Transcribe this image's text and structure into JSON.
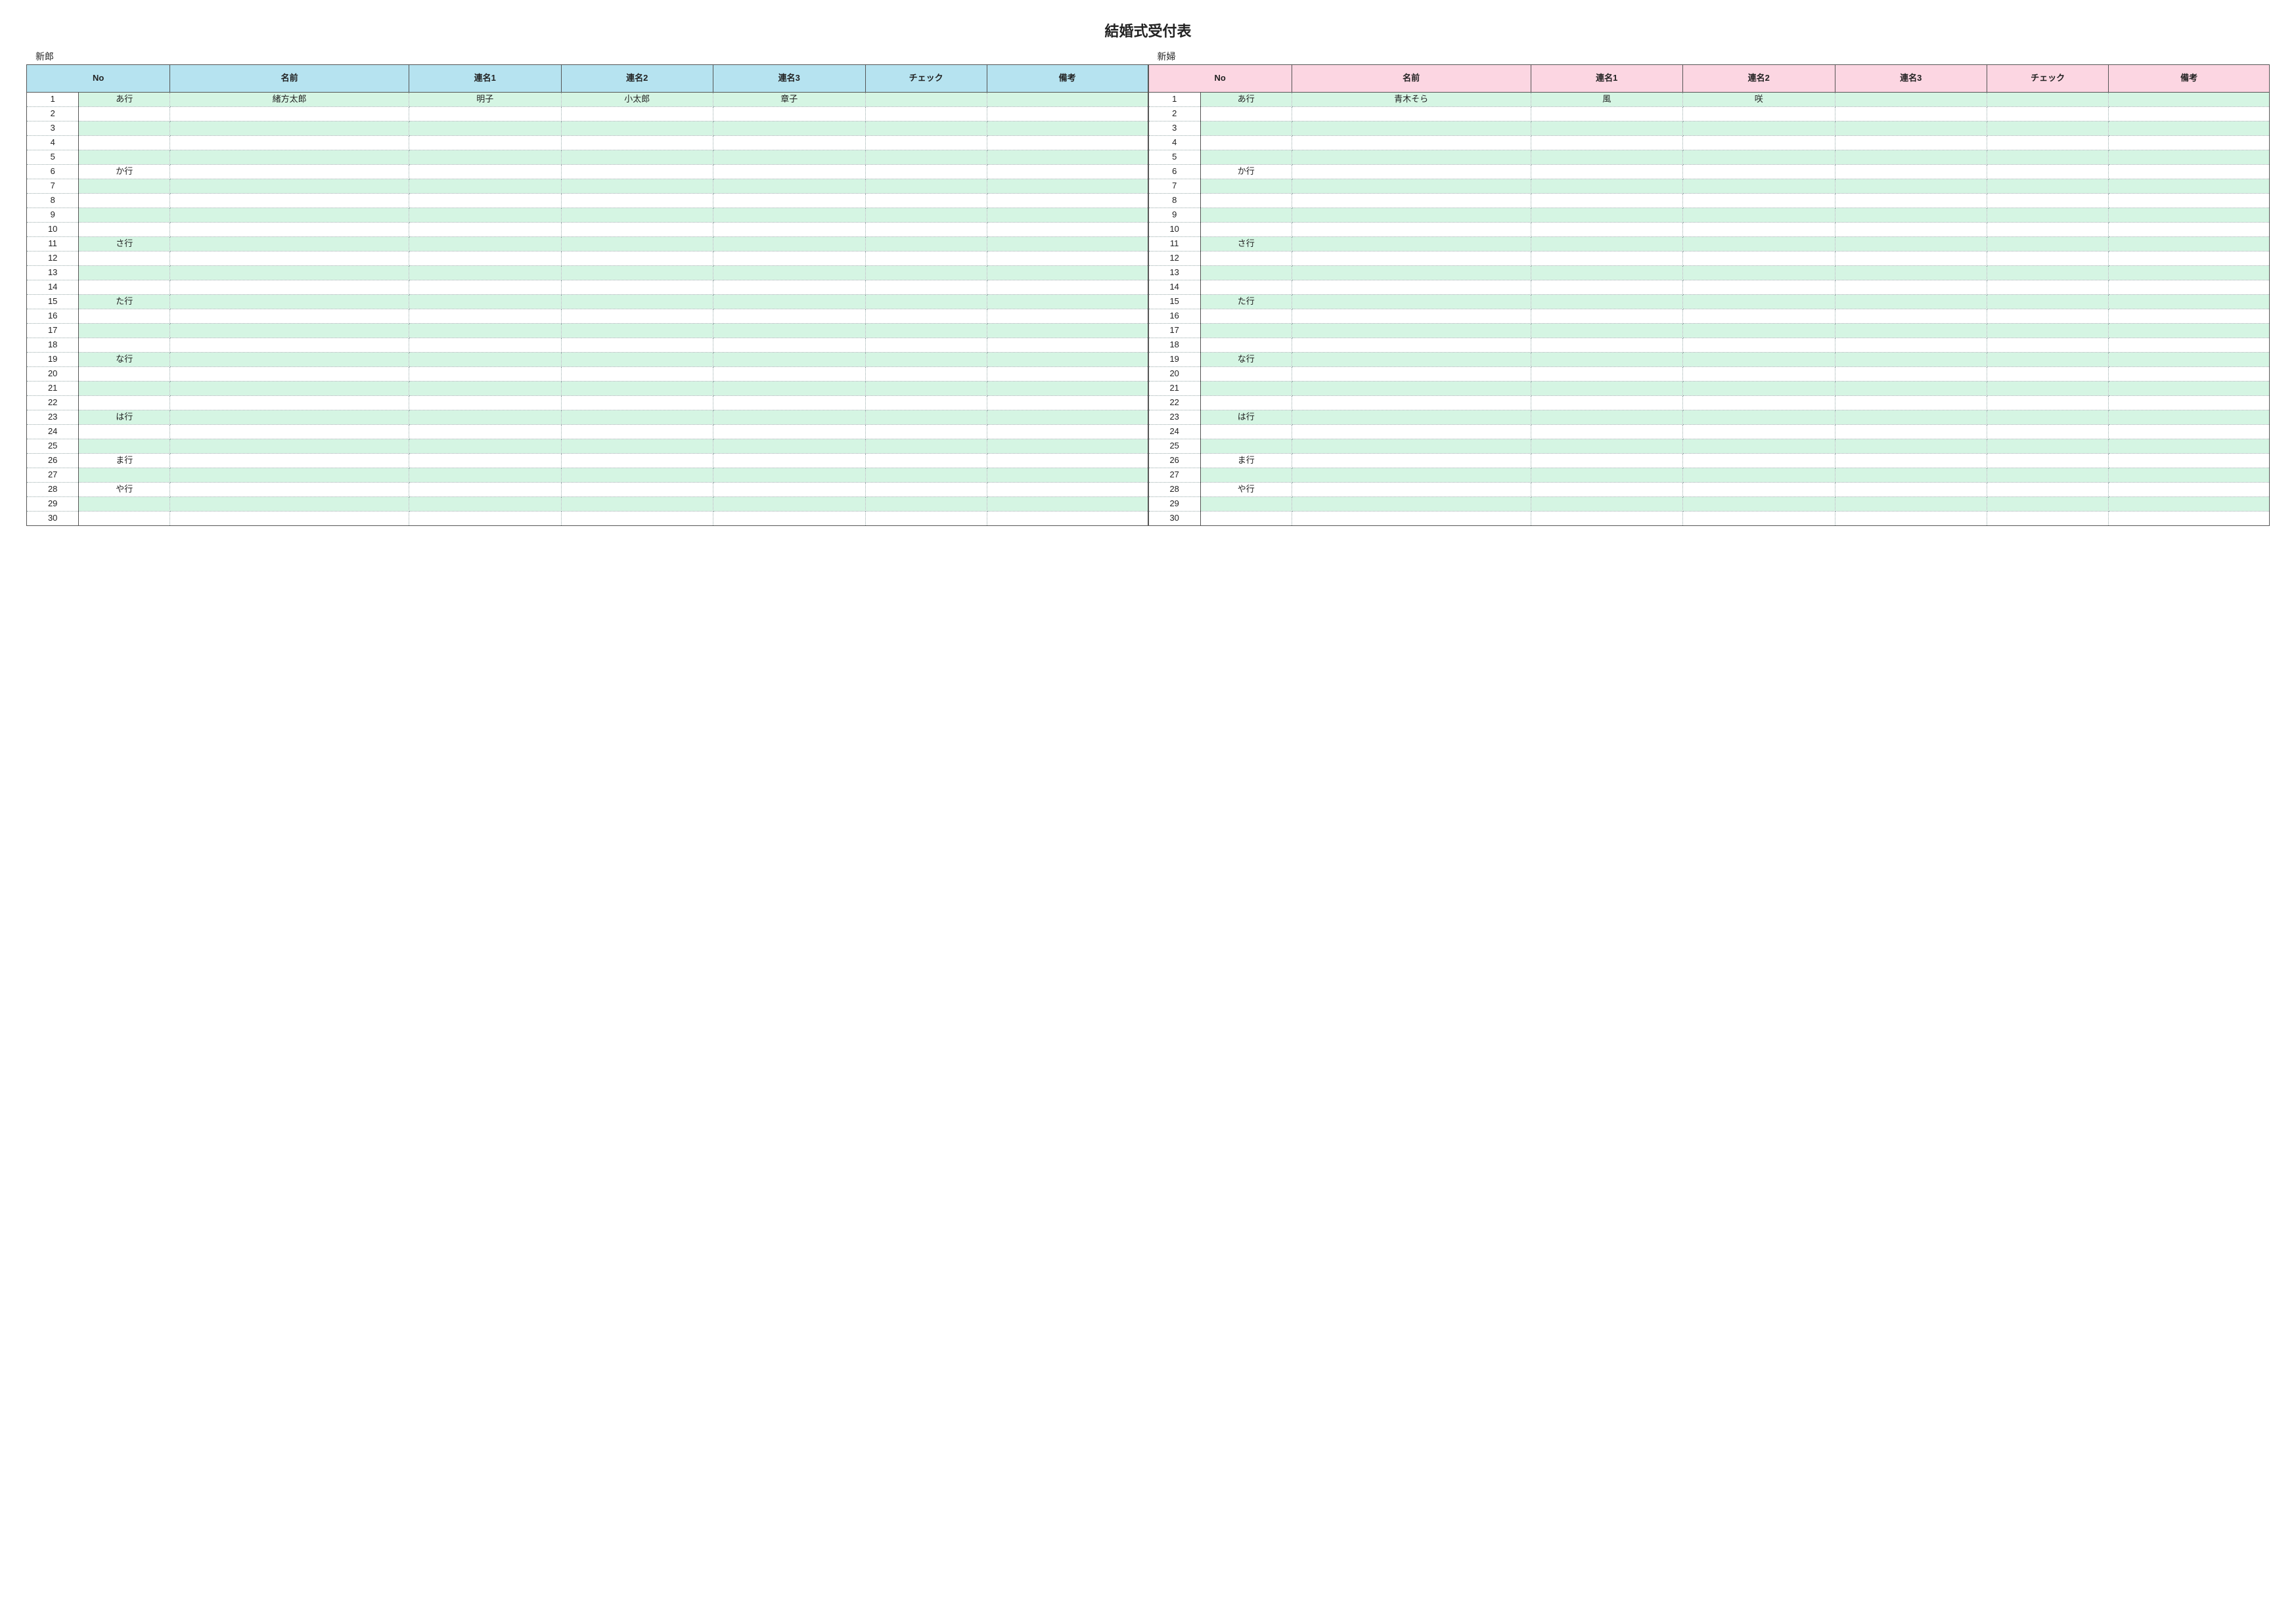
{
  "title": "結婚式受付表",
  "sides": [
    {
      "label": "新郎",
      "header_class": "hdr-blue",
      "columns": [
        "No",
        "名前",
        "連名1",
        "連名2",
        "連名3",
        "チェック",
        "備考"
      ],
      "rows": [
        {
          "n": 1,
          "kana": "あ行",
          "name": "緒方太郎",
          "r1": "明子",
          "r2": "小太郎",
          "r3": "章子",
          "chk": "",
          "rem": ""
        },
        {
          "n": 2,
          "kana": "",
          "name": "",
          "r1": "",
          "r2": "",
          "r3": "",
          "chk": "",
          "rem": ""
        },
        {
          "n": 3,
          "kana": "",
          "name": "",
          "r1": "",
          "r2": "",
          "r3": "",
          "chk": "",
          "rem": ""
        },
        {
          "n": 4,
          "kana": "",
          "name": "",
          "r1": "",
          "r2": "",
          "r3": "",
          "chk": "",
          "rem": ""
        },
        {
          "n": 5,
          "kana": "",
          "name": "",
          "r1": "",
          "r2": "",
          "r3": "",
          "chk": "",
          "rem": ""
        },
        {
          "n": 6,
          "kana": "か行",
          "name": "",
          "r1": "",
          "r2": "",
          "r3": "",
          "chk": "",
          "rem": ""
        },
        {
          "n": 7,
          "kana": "",
          "name": "",
          "r1": "",
          "r2": "",
          "r3": "",
          "chk": "",
          "rem": ""
        },
        {
          "n": 8,
          "kana": "",
          "name": "",
          "r1": "",
          "r2": "",
          "r3": "",
          "chk": "",
          "rem": ""
        },
        {
          "n": 9,
          "kana": "",
          "name": "",
          "r1": "",
          "r2": "",
          "r3": "",
          "chk": "",
          "rem": ""
        },
        {
          "n": 10,
          "kana": "",
          "name": "",
          "r1": "",
          "r2": "",
          "r3": "",
          "chk": "",
          "rem": ""
        },
        {
          "n": 11,
          "kana": "さ行",
          "name": "",
          "r1": "",
          "r2": "",
          "r3": "",
          "chk": "",
          "rem": ""
        },
        {
          "n": 12,
          "kana": "",
          "name": "",
          "r1": "",
          "r2": "",
          "r3": "",
          "chk": "",
          "rem": ""
        },
        {
          "n": 13,
          "kana": "",
          "name": "",
          "r1": "",
          "r2": "",
          "r3": "",
          "chk": "",
          "rem": ""
        },
        {
          "n": 14,
          "kana": "",
          "name": "",
          "r1": "",
          "r2": "",
          "r3": "",
          "chk": "",
          "rem": ""
        },
        {
          "n": 15,
          "kana": "た行",
          "name": "",
          "r1": "",
          "r2": "",
          "r3": "",
          "chk": "",
          "rem": ""
        },
        {
          "n": 16,
          "kana": "",
          "name": "",
          "r1": "",
          "r2": "",
          "r3": "",
          "chk": "",
          "rem": ""
        },
        {
          "n": 17,
          "kana": "",
          "name": "",
          "r1": "",
          "r2": "",
          "r3": "",
          "chk": "",
          "rem": ""
        },
        {
          "n": 18,
          "kana": "",
          "name": "",
          "r1": "",
          "r2": "",
          "r3": "",
          "chk": "",
          "rem": ""
        },
        {
          "n": 19,
          "kana": "な行",
          "name": "",
          "r1": "",
          "r2": "",
          "r3": "",
          "chk": "",
          "rem": ""
        },
        {
          "n": 20,
          "kana": "",
          "name": "",
          "r1": "",
          "r2": "",
          "r3": "",
          "chk": "",
          "rem": ""
        },
        {
          "n": 21,
          "kana": "",
          "name": "",
          "r1": "",
          "r2": "",
          "r3": "",
          "chk": "",
          "rem": ""
        },
        {
          "n": 22,
          "kana": "",
          "name": "",
          "r1": "",
          "r2": "",
          "r3": "",
          "chk": "",
          "rem": ""
        },
        {
          "n": 23,
          "kana": "は行",
          "name": "",
          "r1": "",
          "r2": "",
          "r3": "",
          "chk": "",
          "rem": ""
        },
        {
          "n": 24,
          "kana": "",
          "name": "",
          "r1": "",
          "r2": "",
          "r3": "",
          "chk": "",
          "rem": ""
        },
        {
          "n": 25,
          "kana": "",
          "name": "",
          "r1": "",
          "r2": "",
          "r3": "",
          "chk": "",
          "rem": ""
        },
        {
          "n": 26,
          "kana": "ま行",
          "name": "",
          "r1": "",
          "r2": "",
          "r3": "",
          "chk": "",
          "rem": ""
        },
        {
          "n": 27,
          "kana": "",
          "name": "",
          "r1": "",
          "r2": "",
          "r3": "",
          "chk": "",
          "rem": ""
        },
        {
          "n": 28,
          "kana": "や行",
          "name": "",
          "r1": "",
          "r2": "",
          "r3": "",
          "chk": "",
          "rem": ""
        },
        {
          "n": 29,
          "kana": "",
          "name": "",
          "r1": "",
          "r2": "",
          "r3": "",
          "chk": "",
          "rem": ""
        },
        {
          "n": 30,
          "kana": "",
          "name": "",
          "r1": "",
          "r2": "",
          "r3": "",
          "chk": "",
          "rem": ""
        }
      ]
    },
    {
      "label": "新婦",
      "header_class": "hdr-pink",
      "columns": [
        "No",
        "名前",
        "連名1",
        "連名2",
        "連名3",
        "チェック",
        "備考"
      ],
      "rows": [
        {
          "n": 1,
          "kana": "あ行",
          "name": "青木そら",
          "r1": "風",
          "r2": "咲",
          "r3": "",
          "chk": "",
          "rem": ""
        },
        {
          "n": 2,
          "kana": "",
          "name": "",
          "r1": "",
          "r2": "",
          "r3": "",
          "chk": "",
          "rem": ""
        },
        {
          "n": 3,
          "kana": "",
          "name": "",
          "r1": "",
          "r2": "",
          "r3": "",
          "chk": "",
          "rem": ""
        },
        {
          "n": 4,
          "kana": "",
          "name": "",
          "r1": "",
          "r2": "",
          "r3": "",
          "chk": "",
          "rem": ""
        },
        {
          "n": 5,
          "kana": "",
          "name": "",
          "r1": "",
          "r2": "",
          "r3": "",
          "chk": "",
          "rem": ""
        },
        {
          "n": 6,
          "kana": "か行",
          "name": "",
          "r1": "",
          "r2": "",
          "r3": "",
          "chk": "",
          "rem": ""
        },
        {
          "n": 7,
          "kana": "",
          "name": "",
          "r1": "",
          "r2": "",
          "r3": "",
          "chk": "",
          "rem": ""
        },
        {
          "n": 8,
          "kana": "",
          "name": "",
          "r1": "",
          "r2": "",
          "r3": "",
          "chk": "",
          "rem": ""
        },
        {
          "n": 9,
          "kana": "",
          "name": "",
          "r1": "",
          "r2": "",
          "r3": "",
          "chk": "",
          "rem": ""
        },
        {
          "n": 10,
          "kana": "",
          "name": "",
          "r1": "",
          "r2": "",
          "r3": "",
          "chk": "",
          "rem": ""
        },
        {
          "n": 11,
          "kana": "さ行",
          "name": "",
          "r1": "",
          "r2": "",
          "r3": "",
          "chk": "",
          "rem": ""
        },
        {
          "n": 12,
          "kana": "",
          "name": "",
          "r1": "",
          "r2": "",
          "r3": "",
          "chk": "",
          "rem": ""
        },
        {
          "n": 13,
          "kana": "",
          "name": "",
          "r1": "",
          "r2": "",
          "r3": "",
          "chk": "",
          "rem": ""
        },
        {
          "n": 14,
          "kana": "",
          "name": "",
          "r1": "",
          "r2": "",
          "r3": "",
          "chk": "",
          "rem": ""
        },
        {
          "n": 15,
          "kana": "た行",
          "name": "",
          "r1": "",
          "r2": "",
          "r3": "",
          "chk": "",
          "rem": ""
        },
        {
          "n": 16,
          "kana": "",
          "name": "",
          "r1": "",
          "r2": "",
          "r3": "",
          "chk": "",
          "rem": ""
        },
        {
          "n": 17,
          "kana": "",
          "name": "",
          "r1": "",
          "r2": "",
          "r3": "",
          "chk": "",
          "rem": ""
        },
        {
          "n": 18,
          "kana": "",
          "name": "",
          "r1": "",
          "r2": "",
          "r3": "",
          "chk": "",
          "rem": ""
        },
        {
          "n": 19,
          "kana": "な行",
          "name": "",
          "r1": "",
          "r2": "",
          "r3": "",
          "chk": "",
          "rem": ""
        },
        {
          "n": 20,
          "kana": "",
          "name": "",
          "r1": "",
          "r2": "",
          "r3": "",
          "chk": "",
          "rem": ""
        },
        {
          "n": 21,
          "kana": "",
          "name": "",
          "r1": "",
          "r2": "",
          "r3": "",
          "chk": "",
          "rem": ""
        },
        {
          "n": 22,
          "kana": "",
          "name": "",
          "r1": "",
          "r2": "",
          "r3": "",
          "chk": "",
          "rem": ""
        },
        {
          "n": 23,
          "kana": "は行",
          "name": "",
          "r1": "",
          "r2": "",
          "r3": "",
          "chk": "",
          "rem": ""
        },
        {
          "n": 24,
          "kana": "",
          "name": "",
          "r1": "",
          "r2": "",
          "r3": "",
          "chk": "",
          "rem": ""
        },
        {
          "n": 25,
          "kana": "",
          "name": "",
          "r1": "",
          "r2": "",
          "r3": "",
          "chk": "",
          "rem": ""
        },
        {
          "n": 26,
          "kana": "ま行",
          "name": "",
          "r1": "",
          "r2": "",
          "r3": "",
          "chk": "",
          "rem": ""
        },
        {
          "n": 27,
          "kana": "",
          "name": "",
          "r1": "",
          "r2": "",
          "r3": "",
          "chk": "",
          "rem": ""
        },
        {
          "n": 28,
          "kana": "や行",
          "name": "",
          "r1": "",
          "r2": "",
          "r3": "",
          "chk": "",
          "rem": ""
        },
        {
          "n": 29,
          "kana": "",
          "name": "",
          "r1": "",
          "r2": "",
          "r3": "",
          "chk": "",
          "rem": ""
        },
        {
          "n": 30,
          "kana": "",
          "name": "",
          "r1": "",
          "r2": "",
          "r3": "",
          "chk": "",
          "rem": ""
        }
      ]
    }
  ]
}
